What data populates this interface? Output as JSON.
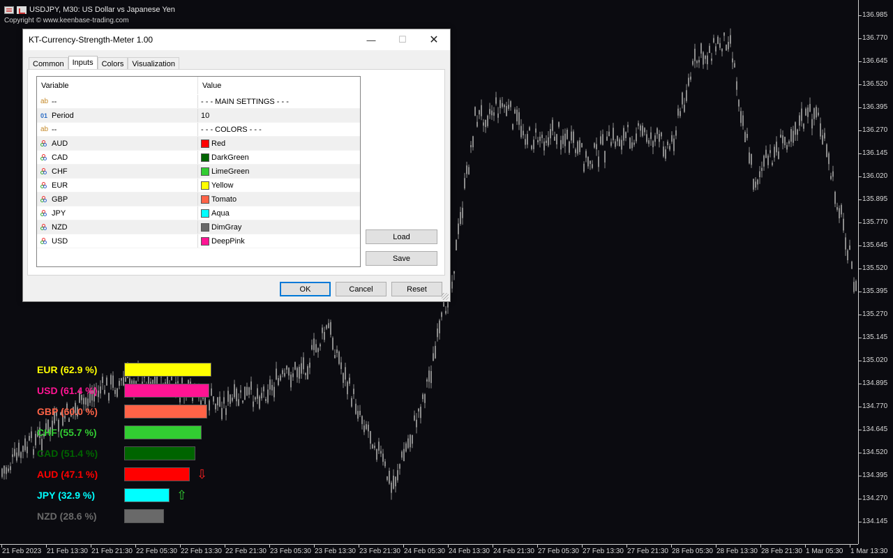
{
  "chart": {
    "symbol_line": "USDJPY, M30:  US Dollar vs Japanese Yen",
    "copyright": "Copyright © www.keenbase-trading.com",
    "price_ticks": [
      "136.985",
      "136.770",
      "136.645",
      "136.520",
      "136.395",
      "136.270",
      "136.145",
      "136.020",
      "135.895",
      "135.770",
      "135.645",
      "135.520",
      "135.395",
      "135.270",
      "135.145",
      "135.020",
      "134.895",
      "134.770",
      "134.645",
      "134.520",
      "134.395",
      "134.270",
      "134.145"
    ],
    "time_ticks": [
      "21 Feb 2023",
      "21 Feb 13:30",
      "21 Feb 21:30",
      "22 Feb 05:30",
      "22 Feb 13:30",
      "22 Feb 21:30",
      "23 Feb 05:30",
      "23 Feb 13:30",
      "23 Feb 21:30",
      "24 Feb 05:30",
      "24 Feb 13:30",
      "24 Feb 21:30",
      "27 Feb 05:30",
      "27 Feb 13:30",
      "27 Feb 21:30",
      "28 Feb 05:30",
      "28 Feb 13:30",
      "28 Feb 21:30",
      "1 Mar 05:30",
      "1 Mar 13:30"
    ],
    "candle_color": "#8c8c8c"
  },
  "meter": {
    "rows": [
      {
        "label": "EUR (62.9 %)",
        "color": "#ffff00",
        "value": 62.9,
        "arrow": ""
      },
      {
        "label": "USD (61.4 %)",
        "color": "#ff1493",
        "value": 61.4,
        "arrow": ""
      },
      {
        "label": "GBP (60.0 %)",
        "color": "#ff6347",
        "value": 60.0,
        "arrow": ""
      },
      {
        "label": "CHF (55.7 %)",
        "color": "#32cd32",
        "value": 55.7,
        "arrow": ""
      },
      {
        "label": "CAD (51.4 %)",
        "color": "#006400",
        "value": 51.4,
        "arrow": ""
      },
      {
        "label": "AUD (47.1 %)",
        "color": "#ff0000",
        "value": 47.1,
        "arrow": "⇩",
        "arrow_color": "#ff2020"
      },
      {
        "label": "JPY (32.9 %)",
        "color": "#00ffff",
        "value": 32.9,
        "arrow": "⇧",
        "arrow_color": "#32cd32"
      },
      {
        "label": "NZD (28.6 %)",
        "color": "#696969",
        "value": 28.6,
        "arrow": ""
      }
    ]
  },
  "dialog": {
    "title": "KT-Currency-Strength-Meter 1.00",
    "minimize": "—",
    "maximize": "☐",
    "close": "✕",
    "tabs": [
      "Common",
      "Inputs",
      "Colors",
      "Visualization"
    ],
    "active_tab": "Inputs",
    "columns": {
      "variable": "Variable",
      "value": "Value"
    },
    "rows": [
      {
        "type": "ab",
        "type_label": "ab",
        "variable": "--",
        "value": "- - - MAIN SETTINGS - - -"
      },
      {
        "type": "num",
        "type_label": "01",
        "variable": "Period",
        "value": "10"
      },
      {
        "type": "ab",
        "type_label": "ab",
        "variable": "--",
        "value": "- - - COLORS - - -"
      },
      {
        "type": "color",
        "variable": "AUD",
        "value": "Red",
        "swatch": "#ff0000"
      },
      {
        "type": "color",
        "variable": "CAD",
        "value": "DarkGreen",
        "swatch": "#006400"
      },
      {
        "type": "color",
        "variable": "CHF",
        "value": "LimeGreen",
        "swatch": "#32cd32"
      },
      {
        "type": "color",
        "variable": "EUR",
        "value": "Yellow",
        "swatch": "#ffff00"
      },
      {
        "type": "color",
        "variable": "GBP",
        "value": "Tomato",
        "swatch": "#ff6347"
      },
      {
        "type": "color",
        "variable": "JPY",
        "value": "Aqua",
        "swatch": "#00ffff"
      },
      {
        "type": "color",
        "variable": "NZD",
        "value": "DimGray",
        "swatch": "#696969"
      },
      {
        "type": "color",
        "variable": "USD",
        "value": "DeepPink",
        "swatch": "#ff1493"
      }
    ],
    "load_label": "Load",
    "save_label": "Save",
    "ok_label": "OK",
    "cancel_label": "Cancel",
    "reset_label": "Reset"
  }
}
